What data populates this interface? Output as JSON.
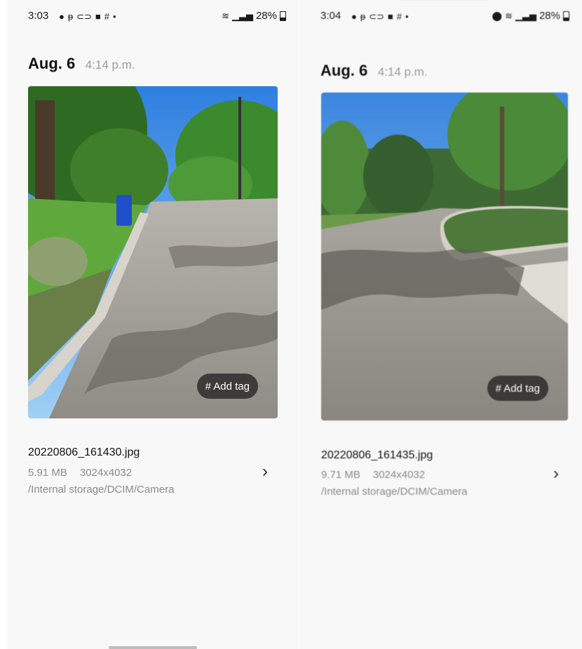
{
  "screens": [
    {
      "status": {
        "time": "3:03",
        "battery": "28%"
      },
      "date": "Aug. 6",
      "time": "4:14 p.m.",
      "tag_label": "# Add tag",
      "file_name": "20220806_161430.jpg",
      "file_size": "5.91 MB",
      "resolution": "3024x4032",
      "path": "/Internal storage/DCIM/Camera"
    },
    {
      "status": {
        "time": "3:04",
        "battery": "28%"
      },
      "date": "Aug. 6",
      "time": "4:14 p.m.",
      "tag_label": "# Add tag",
      "file_name": "20220806_161435.jpg",
      "file_size": "9.71 MB",
      "resolution": "3024x4032",
      "path": "/Internal storage/DCIM/Camera"
    }
  ],
  "icons": [
    "messenger-icon",
    "hotspot-icon",
    "usb-icon",
    "bixby-icon",
    "grid-icon",
    "dot-icon",
    "location-icon",
    "wifi-icon",
    "signal-icon",
    "battery-icon",
    "chevron-right-icon"
  ]
}
